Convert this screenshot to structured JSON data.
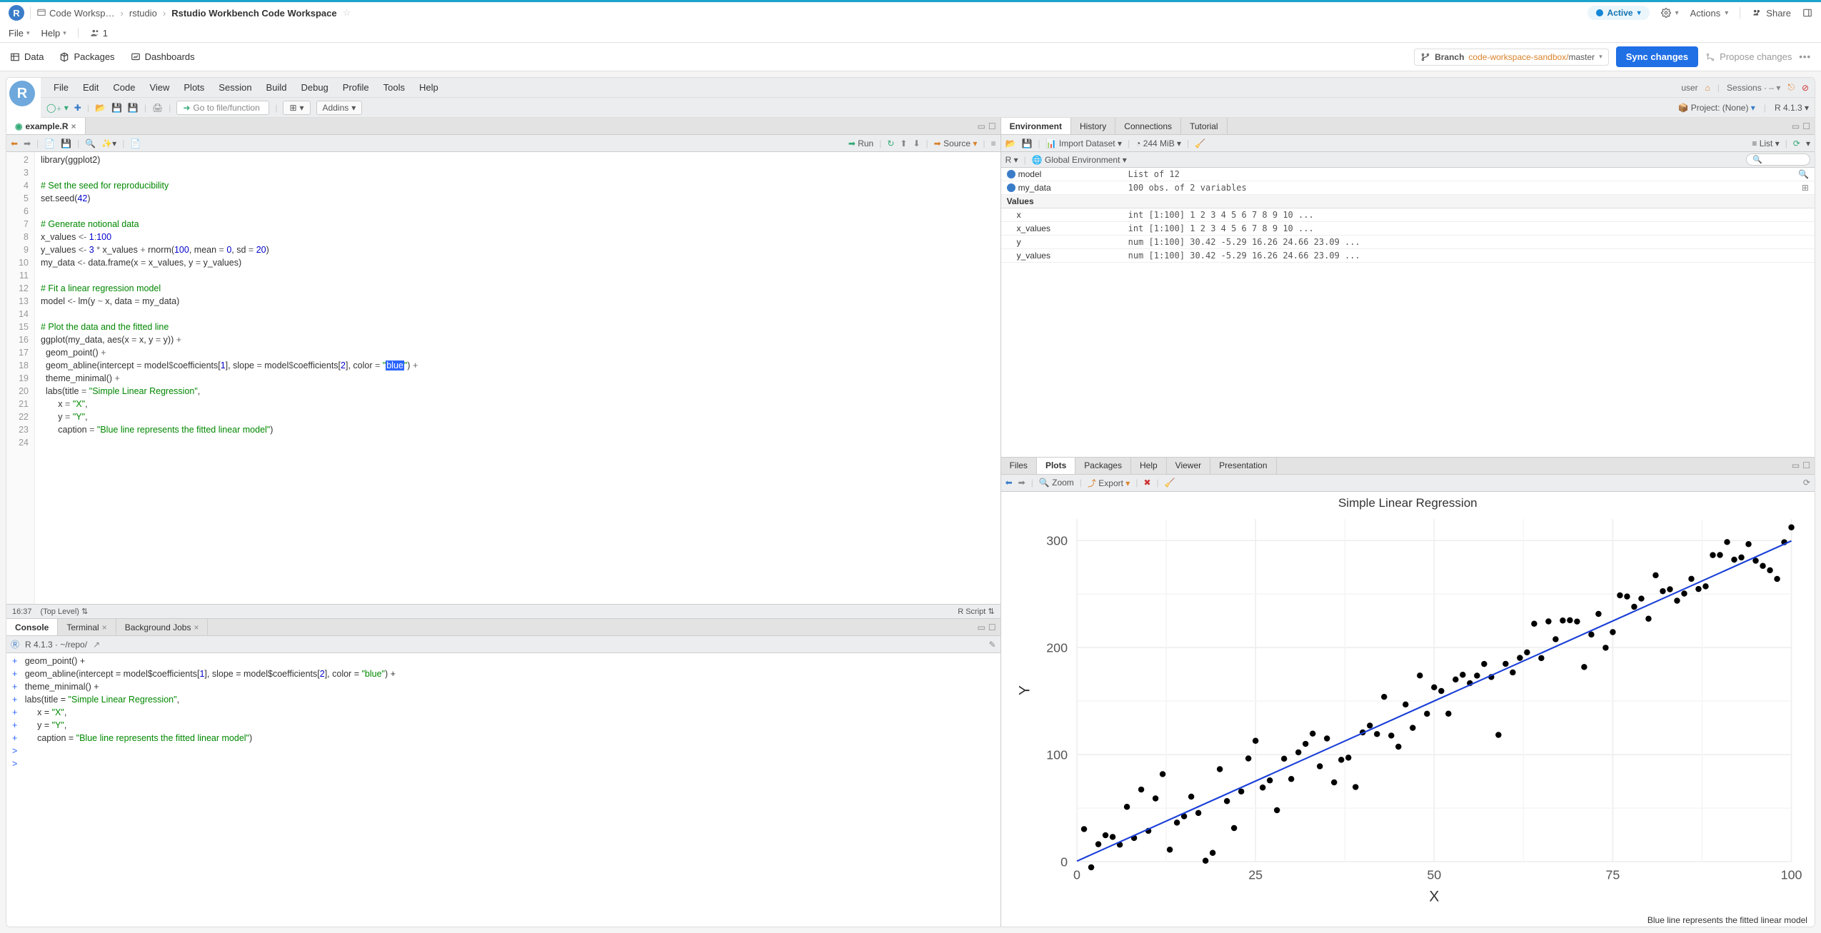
{
  "topbar": {
    "breadcrumb": [
      "Code Worksp…",
      "rstudio",
      "Rstudio Workbench Code Workspace"
    ],
    "file": "File",
    "help": "Help",
    "users_count": "1",
    "active": "Active",
    "actions": "Actions",
    "share": "Share"
  },
  "secbar": {
    "data": "Data",
    "packages": "Packages",
    "dashboards": "Dashboards",
    "branch_label": "Branch",
    "branch_path": "code-workspace-sandbox/",
    "branch_name": "master",
    "sync": "Sync changes",
    "propose": "Propose changes"
  },
  "rstudio": {
    "menus": [
      "File",
      "Edit",
      "Code",
      "View",
      "Plots",
      "Session",
      "Build",
      "Debug",
      "Profile",
      "Tools",
      "Help"
    ],
    "user": "user",
    "sessions": "Sessions ·",
    "goto": "Go to file/function",
    "addins": "Addins",
    "project": "Project: (None)",
    "r_version": "R 4.1.3"
  },
  "editor": {
    "filename": "example.R",
    "run": "Run",
    "source": "Source",
    "cursor": "16:37",
    "scope": "(Top Level)",
    "lang": "R Script",
    "lines": [
      {
        "n": 2,
        "html": "<span class='c-fn'>library</span>(ggplot2)"
      },
      {
        "n": 3,
        "html": ""
      },
      {
        "n": 4,
        "html": "<span class='c-com'># Set the seed for reproducibility</span>"
      },
      {
        "n": 5,
        "html": "<span class='c-fn'>set.seed</span>(<span class='c-num'>42</span>)"
      },
      {
        "n": 6,
        "html": ""
      },
      {
        "n": 7,
        "html": "<span class='c-com'># Generate notional data</span>"
      },
      {
        "n": 8,
        "html": "x_values <span class='c-op'>&lt;-</span> <span class='c-num'>1</span><span class='c-op'>:</span><span class='c-num'>100</span>"
      },
      {
        "n": 9,
        "html": "y_values <span class='c-op'>&lt;-</span> <span class='c-num'>3</span> <span class='c-op'>*</span> x_values <span class='c-op'>+</span> <span class='c-fn'>rnorm</span>(<span class='c-num'>100</span>, mean <span class='c-op'>=</span> <span class='c-num'>0</span>, sd <span class='c-op'>=</span> <span class='c-num'>20</span>)"
      },
      {
        "n": 10,
        "html": "my_data <span class='c-op'>&lt;-</span> <span class='c-fn'>data.frame</span>(x <span class='c-op'>=</span> x_values, y <span class='c-op'>=</span> y_values)"
      },
      {
        "n": 11,
        "html": ""
      },
      {
        "n": 12,
        "html": "<span class='c-com'># Fit a linear regression model</span>"
      },
      {
        "n": 13,
        "html": "model <span class='c-op'>&lt;-</span> <span class='c-fn'>lm</span>(y <span class='c-op'>~</span> x, data <span class='c-op'>=</span> my_data)"
      },
      {
        "n": 14,
        "html": ""
      },
      {
        "n": 15,
        "html": "<span class='c-com'># Plot the data and the fitted line</span>"
      },
      {
        "n": 16,
        "html": "<span class='c-fn'>ggplot</span>(my_data, <span class='c-fn'>aes</span>(x <span class='c-op'>=</span> x, y <span class='c-op'>=</span> y)) <span class='c-op'>+</span>"
      },
      {
        "n": 17,
        "html": "  <span class='c-fn'>geom_point</span>() <span class='c-op'>+</span>"
      },
      {
        "n": 18,
        "html": "  <span class='c-fn'>geom_abline</span>(intercept <span class='c-op'>=</span> model<span class='c-op'>$</span>coefficients[<span class='c-num'>1</span>], slope <span class='c-op'>=</span> model<span class='c-op'>$</span>coefficients[<span class='c-num'>2</span>], color <span class='c-op'>=</span> <span class='c-str'>\"</span><span class='hl'>blue</span><span class='c-str'>\"</span>) <span class='c-op'>+</span>"
      },
      {
        "n": 19,
        "html": "  <span class='c-fn'>theme_minimal</span>() <span class='c-op'>+</span>"
      },
      {
        "n": 20,
        "html": "  <span class='c-fn'>labs</span>(title <span class='c-op'>=</span> <span class='c-str'>\"Simple Linear Regression\"</span>,"
      },
      {
        "n": 21,
        "html": "       x <span class='c-op'>=</span> <span class='c-str'>\"X\"</span>,"
      },
      {
        "n": 22,
        "html": "       y <span class='c-op'>=</span> <span class='c-str'>\"Y\"</span>,"
      },
      {
        "n": 23,
        "html": "       caption <span class='c-op'>=</span> <span class='c-str'>\"Blue line represents the fitted linear model\"</span>)"
      },
      {
        "n": 24,
        "html": ""
      }
    ]
  },
  "console": {
    "tabs": [
      "Console",
      "Terminal",
      "Background Jobs"
    ],
    "active_tab": 0,
    "prompt_info": "R 4.1.3 · ~/repo/",
    "lines": [
      {
        "p": "+",
        "html": "   <span class='c-fn'>geom_point</span>() +"
      },
      {
        "p": "+",
        "html": "   <span class='c-fn'>geom_abline</span>(intercept = model$coefficients[<span class='c-num'>1</span>], slope = model$coefficients[<span class='c-num'>2</span>], color = <span class='c-str'>\"blue\"</span>) +"
      },
      {
        "p": "+",
        "html": "   <span class='c-fn'>theme_minimal</span>() +"
      },
      {
        "p": "+",
        "html": "   <span class='c-fn'>labs</span>(title = <span class='c-str'>\"Simple Linear Regression\"</span>,"
      },
      {
        "p": "+",
        "html": "        x = <span class='c-str'>\"X\"</span>,"
      },
      {
        "p": "+",
        "html": "        y = <span class='c-str'>\"Y\"</span>,"
      },
      {
        "p": "+",
        "html": "        caption = <span class='c-str'>\"Blue line represents the fitted linear model\"</span>)"
      },
      {
        "p": ">",
        "html": ""
      },
      {
        "p": ">",
        "html": " "
      }
    ]
  },
  "env": {
    "tabs": [
      "Environment",
      "History",
      "Connections",
      "Tutorial"
    ],
    "active_tab": 0,
    "import": "Import Dataset",
    "mem": "244 MiB",
    "scope_label": "R",
    "global_env": "Global Environment",
    "list": "List",
    "rows": [
      {
        "icon": "blue",
        "name": "model",
        "val": "List of  12",
        "search": true
      },
      {
        "icon": "arrow",
        "name": "my_data",
        "val": "100 obs. of 2 variables",
        "table": true
      }
    ],
    "values_label": "Values",
    "values": [
      {
        "name": "x",
        "val": "int [1:100] 1 2 3 4 5 6 7 8 9 10 ..."
      },
      {
        "name": "x_values",
        "val": "int [1:100] 1 2 3 4 5 6 7 8 9 10 ..."
      },
      {
        "name": "y",
        "val": "num [1:100] 30.42 -5.29 16.26 24.66 23.09 ..."
      },
      {
        "name": "y_values",
        "val": "num [1:100] 30.42 -5.29 16.26 24.66 23.09 ..."
      }
    ]
  },
  "plots": {
    "tabs": [
      "Files",
      "Plots",
      "Packages",
      "Help",
      "Viewer",
      "Presentation"
    ],
    "active_tab": 1,
    "zoom": "Zoom",
    "export": "Export",
    "caption": "Blue line represents the fitted linear model"
  },
  "chart_data": {
    "type": "scatter",
    "title": "Simple Linear Regression",
    "xlabel": "X",
    "ylabel": "Y",
    "xlim": [
      0,
      100
    ],
    "ylim": [
      0,
      320
    ],
    "x_ticks": [
      0,
      25,
      50,
      75,
      100
    ],
    "y_ticks": [
      0,
      100,
      200,
      300
    ],
    "series": [
      {
        "name": "points",
        "type": "scatter",
        "x": [
          1,
          2,
          3,
          4,
          5,
          6,
          7,
          8,
          9,
          10,
          11,
          12,
          13,
          14,
          15,
          16,
          17,
          18,
          19,
          20,
          21,
          22,
          23,
          24,
          25,
          26,
          27,
          28,
          29,
          30,
          31,
          32,
          33,
          34,
          35,
          36,
          37,
          38,
          39,
          40,
          41,
          42,
          43,
          44,
          45,
          46,
          47,
          48,
          49,
          50,
          51,
          52,
          53,
          54,
          55,
          56,
          57,
          58,
          59,
          60,
          61,
          62,
          63,
          64,
          65,
          66,
          67,
          68,
          69,
          70,
          71,
          72,
          73,
          74,
          75,
          76,
          77,
          78,
          79,
          80,
          81,
          82,
          83,
          84,
          85,
          86,
          87,
          88,
          89,
          90,
          91,
          92,
          93,
          94,
          95,
          96,
          97,
          98,
          99,
          100
        ],
        "y": [
          30.42,
          -5.29,
          16.26,
          24.66,
          23.09,
          15.88,
          51.21,
          22.11,
          67.35,
          28.75,
          59.07,
          81.76,
          11.23,
          36.43,
          42.33,
          60.71,
          45.44,
          0.88,
          8.21,
          86.41,
          56.57,
          31.37,
          65.51,
          96.41,
          112.86,
          69.19,
          75.91,
          48.06,
          96.17,
          77.23,
          102.1,
          110.02,
          119.6,
          89.08,
          115.05,
          74.03,
          95.16,
          97.11,
          69.68,
          120.72,
          127.1,
          119.19,
          153.94,
          117.76,
          107.37,
          146.84,
          124.96,
          173.85,
          138.16,
          162.85,
          159.38,
          138.22,
          170.17,
          174.55,
          166.69,
          173.76,
          184.63,
          172.45,
          118.37,
          184.78,
          176.76,
          190.31,
          195.5,
          222.22,
          190.12,
          224.43,
          207.77,
          225.24,
          225.48,
          224.29,
          181.81,
          212.15,
          231.39,
          199.79,
          214.38,
          248.77,
          247.65,
          238.09,
          245.7,
          226.89,
          267.52,
          252.63,
          254.4,
          243.72,
          250.39,
          264.16,
          254.68,
          257.14,
          286.35,
          286.44,
          298.54,
          282.06,
          284.14,
          296.59,
          281.07,
          276.28,
          272.15,
          264.09,
          298.32,
          312.26
        ]
      },
      {
        "name": "fit",
        "type": "line",
        "color": "#1a3fd8",
        "x": [
          0,
          100
        ],
        "y": [
          0.5,
          299.6
        ]
      }
    ]
  }
}
